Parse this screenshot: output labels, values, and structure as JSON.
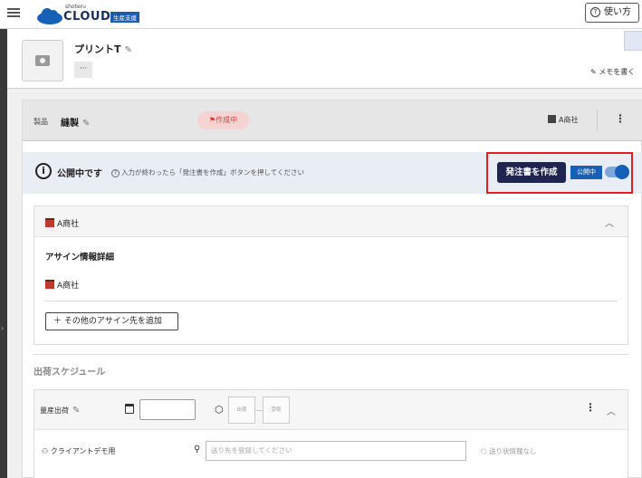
{
  "topbar": {
    "logo_small": "shoteru",
    "logo_text": "CLOUD",
    "logo_badge": "生産支援",
    "help_label": "使い方"
  },
  "product": {
    "name": "プリントT",
    "memo_label": "メモを書く",
    "more_label": "···"
  },
  "panel": {
    "label": "製品",
    "value": "縫製",
    "status": "作成中",
    "company": "A商社"
  },
  "publish": {
    "title": "公開中です",
    "hint": "入力が終わったら「発注書を作成」ボタンを押してください",
    "order_button": "発注書を作成",
    "badge": "公開中",
    "toggle_on": true
  },
  "assign": {
    "header_company": "A商社",
    "detail_title": "アサイン情報詳細",
    "company": "A商社",
    "add_button": "＋ その他のアサイン先を追加"
  },
  "schedule": {
    "title": "出荷スケジュール",
    "mass_label": "量産出荷",
    "date_value": "",
    "steps": [
      "出荷",
      "受取"
    ],
    "client": "クライアントデモ用",
    "destination_placeholder": "送り先を登録してください",
    "ship_info": "送り状情報なし"
  },
  "colors": {
    "accent_navy": "#1f2450",
    "publish_blue": "#1660b8",
    "highlight_red": "#e0201c",
    "status_red": "#d83a3a"
  }
}
